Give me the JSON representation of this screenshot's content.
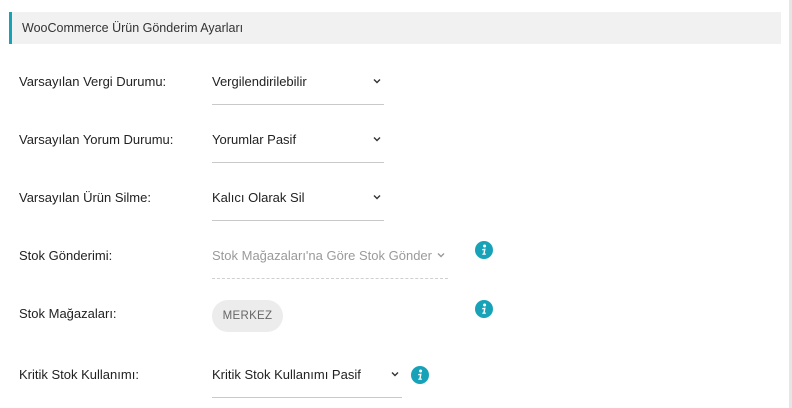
{
  "header": {
    "title": "WooCommerce Ürün Gönderim Ayarları"
  },
  "fields": {
    "tax_status": {
      "label": "Varsayılan Vergi Durumu:",
      "value": "Vergilendirilebilir"
    },
    "review_status": {
      "label": "Varsayılan Yorum Durumu:",
      "value": "Yorumlar Pasif"
    },
    "product_delete": {
      "label": "Varsayılan Ürün Silme:",
      "value": "Kalıcı Olarak Sil"
    },
    "stock_sending": {
      "label": "Stok Gönderimi:",
      "value": "Stok Mağazaları'na Göre Stok Gönder"
    },
    "stock_stores": {
      "label": "Stok Mağazaları:",
      "chip": "MERKEZ"
    },
    "critical_stock": {
      "label": "Kritik Stok Kullanımı:",
      "value": "Kritik Stok Kullanımı Pasif"
    }
  },
  "colors": {
    "accent": "#17a2b8",
    "info_icon": "#17a2b8"
  }
}
